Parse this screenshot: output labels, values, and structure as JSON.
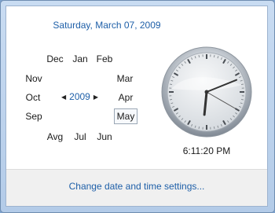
{
  "header": {
    "date": "Saturday, March 07, 2009"
  },
  "calendar": {
    "months": [
      {
        "key": "dec",
        "label": "Dec"
      },
      {
        "key": "jan",
        "label": "Jan"
      },
      {
        "key": "feb",
        "label": "Feb"
      },
      {
        "key": "nov",
        "label": "Nov"
      },
      {
        "key": "mar",
        "label": "Mar"
      },
      {
        "key": "oct",
        "label": "Oct"
      },
      {
        "key": "apr",
        "label": "Apr"
      },
      {
        "key": "sep",
        "label": "Sep"
      },
      {
        "key": "may",
        "label": "May"
      },
      {
        "key": "avg",
        "label": "Avg"
      },
      {
        "key": "jul",
        "label": "Jul"
      },
      {
        "key": "jun",
        "label": "Jun"
      }
    ],
    "year": "2009",
    "selected": "May"
  },
  "clock": {
    "time_text": "6:11:20 PM",
    "hour": 18,
    "minute": 11,
    "second": 20,
    "face_color": "#e4e7ea",
    "hand_color": "#333333",
    "second_hand_color": "#555555"
  },
  "footer": {
    "link_text": "Change date and time settings..."
  }
}
